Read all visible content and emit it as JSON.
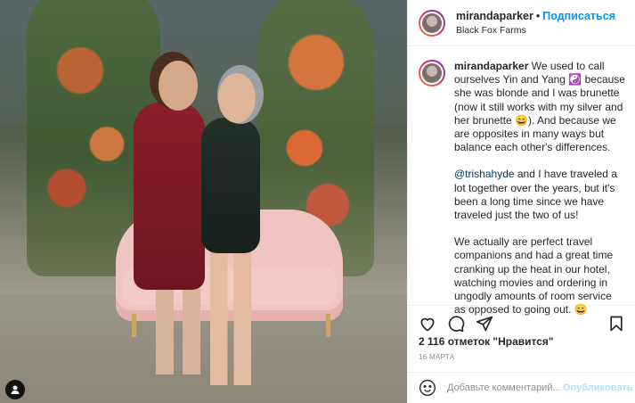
{
  "post": {
    "username": "mirandaparker",
    "follow_label": "Подписаться",
    "dot": "•",
    "location": "Black Fox Farms"
  },
  "caption": {
    "username": "mirandaparker",
    "p1": " We used to call ourselves Yin and Yang ☯️ because she was blonde and I was brunette (now it still works with my silver and her brunette 😄). And because we are opposites in many ways but balance each other's differences.",
    "mention": "@trishahyde",
    "p2_rest": " and I have traveled a lot together over the years, but it's been a long time since we have traveled just the two of us!",
    "p3": "We actually are perfect travel companions and had a great time cranking up the heat in our hotel, watching movies and ordering in ungodly amounts of room service as opposed to going out. 😄"
  },
  "stats": {
    "likes_text": "2 116 отметок \"Нравится\"",
    "date": "16 МАРТА"
  },
  "comment": {
    "placeholder": "Добавьте комментарий...",
    "publish_label": "Опубликовать"
  },
  "icons": {
    "like": "heart-icon",
    "comment": "comment-icon",
    "share": "share-icon",
    "save": "bookmark-icon",
    "emoji": "smiley-icon",
    "tag": "user-tag-icon"
  }
}
